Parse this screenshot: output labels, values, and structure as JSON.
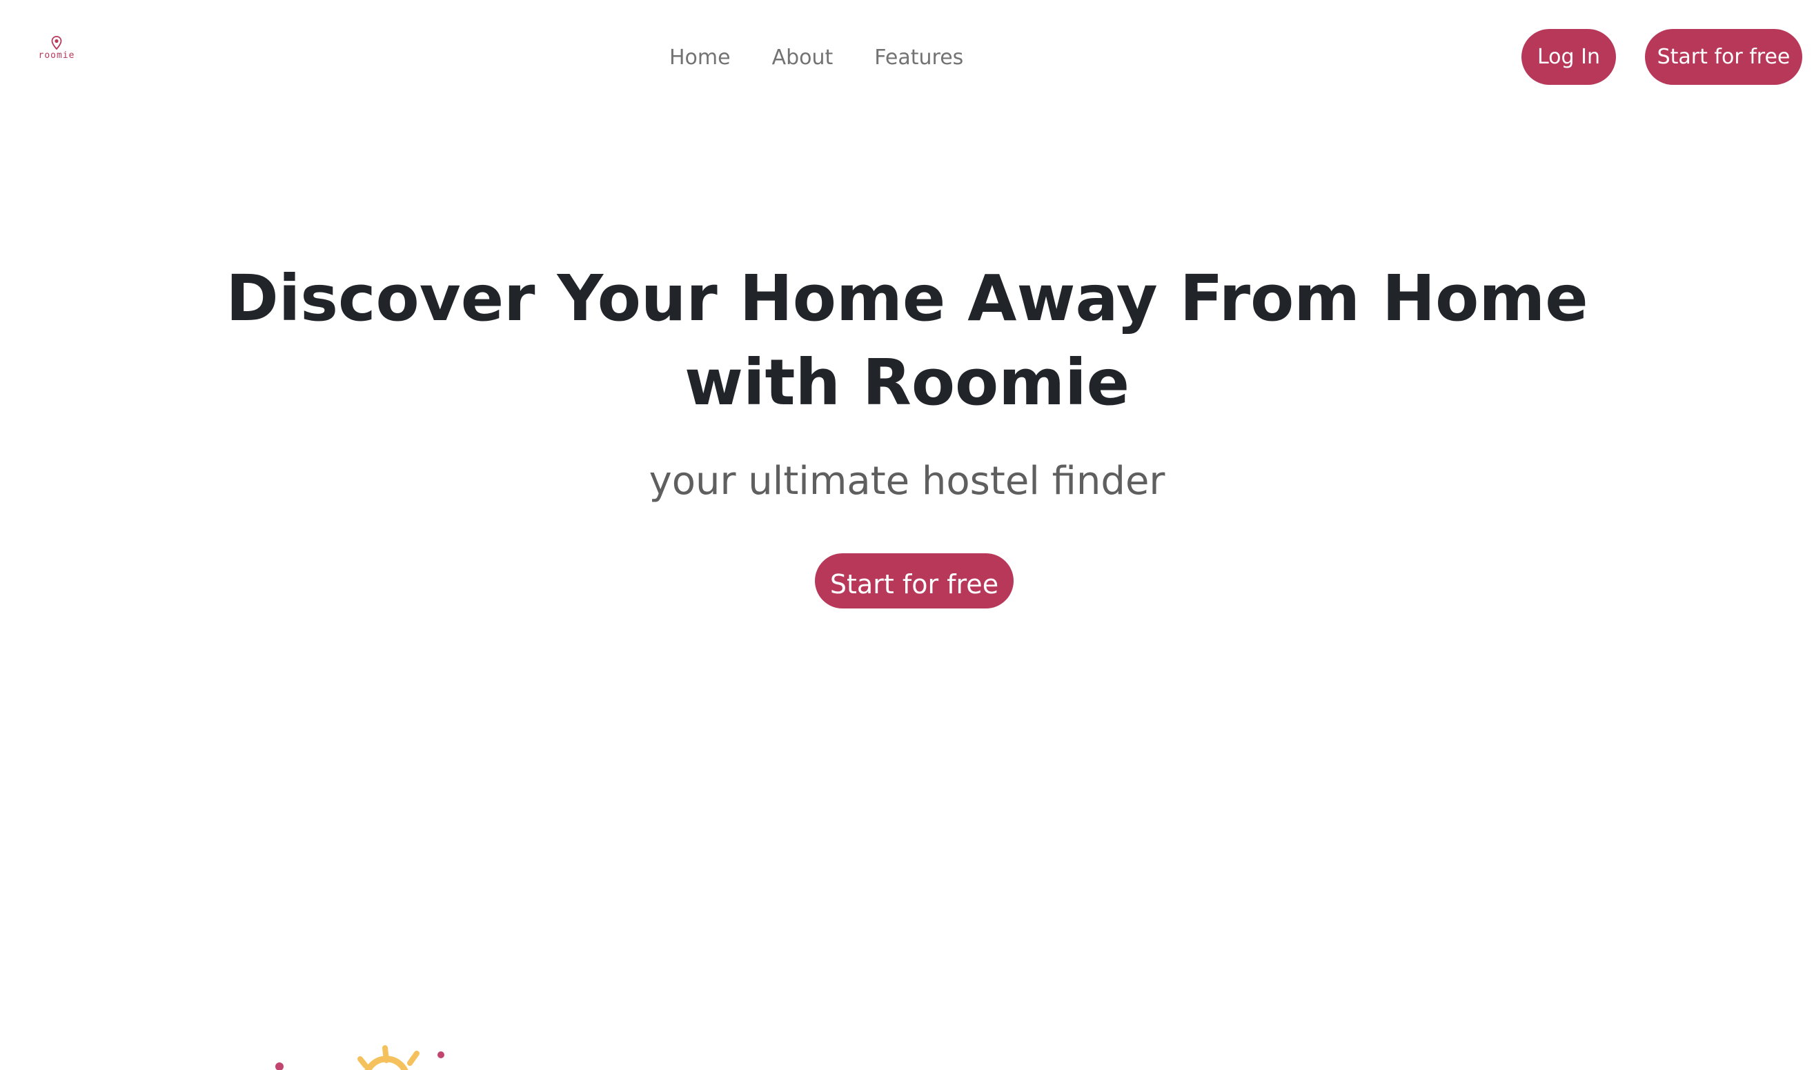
{
  "brand": {
    "logo_text": "roomie",
    "accent_color": "#b8385a"
  },
  "nav": {
    "items": [
      {
        "label": "Home"
      },
      {
        "label": "About"
      },
      {
        "label": "Features"
      }
    ]
  },
  "header_actions": {
    "login_label": "Log In",
    "start_label": "Start for free"
  },
  "hero": {
    "title": "Discover Your Home Away From Home with Roomie",
    "subtitle": "your ultimate hostel finder",
    "cta_label": "Start for free"
  },
  "decor": {
    "icon": "sun-illustration-icon",
    "sun_color": "#f5c15c",
    "dot_color": "#c2456f"
  }
}
